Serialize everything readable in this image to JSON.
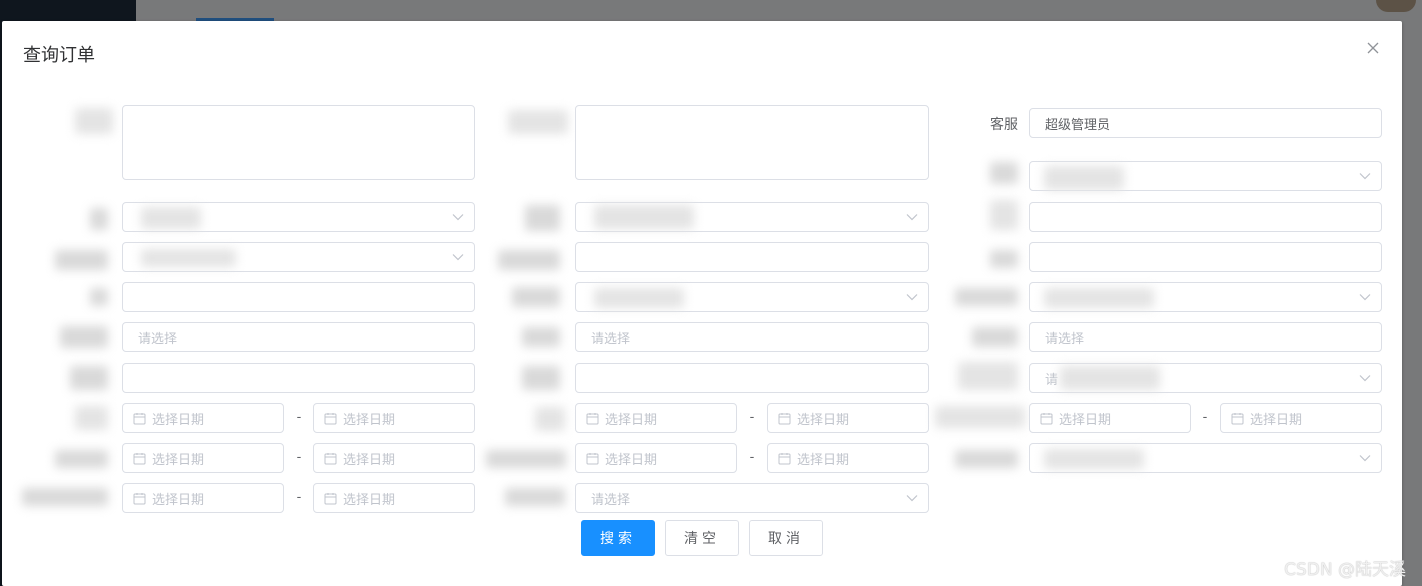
{
  "dialog": {
    "title": "查询订单",
    "close_icon": "close-icon"
  },
  "labels": {
    "customer_service": "客服"
  },
  "values": {
    "customer_service": "超级管理员"
  },
  "placeholders": {
    "select": "请选择",
    "select_partial": "请",
    "date": "选择日期"
  },
  "separators": {
    "range": "-"
  },
  "buttons": {
    "search": "搜索",
    "clear": "清空",
    "cancel": "取消"
  },
  "watermark": "CSDN @陆天溪",
  "colors": {
    "primary": "#1890ff",
    "border": "#dcdfe6",
    "placeholder": "#c0c4cc",
    "text": "#606266"
  }
}
